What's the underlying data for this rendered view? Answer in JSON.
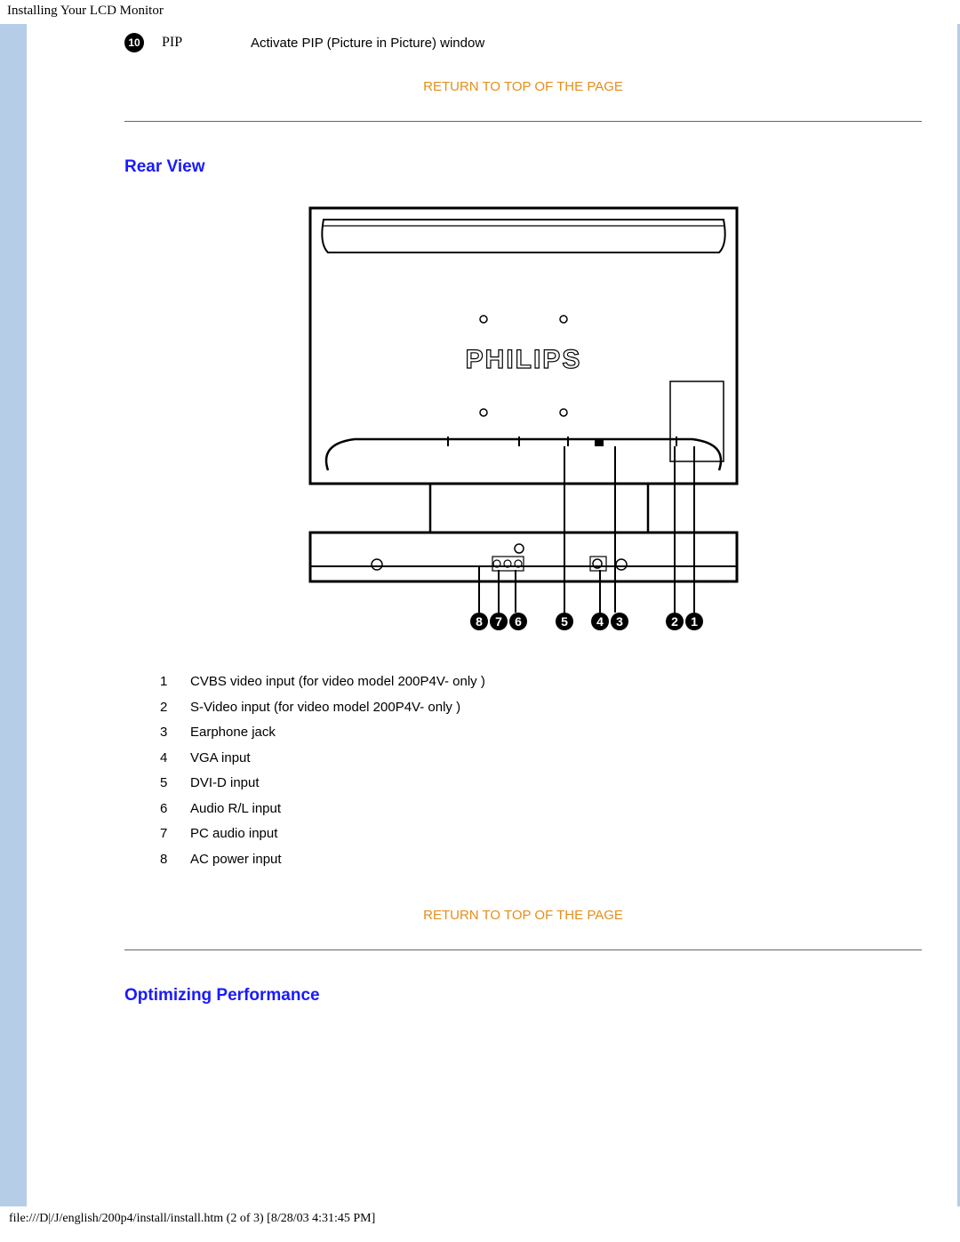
{
  "header": {
    "title": "Installing Your LCD Monitor"
  },
  "pip": {
    "badge": "10",
    "label": "PIP",
    "desc": "Activate PIP (Picture in Picture) window"
  },
  "links": {
    "return_top": "RETURN TO TOP OF THE PAGE"
  },
  "sections": {
    "rear_view": "Rear View",
    "optimizing": "Optimizing Performance"
  },
  "diagram": {
    "brand": "PHILIPS",
    "callouts": [
      "8",
      "7",
      "6",
      "5",
      "4",
      "3",
      "2",
      "1"
    ]
  },
  "ports": [
    {
      "n": "1",
      "label": "CVBS video input (for video model 200P4V- only )"
    },
    {
      "n": "2",
      "label": "S-Video input (for video model 200P4V- only )"
    },
    {
      "n": "3",
      "label": "Earphone jack"
    },
    {
      "n": "4",
      "label": "VGA input"
    },
    {
      "n": "5",
      "label": "DVI-D input"
    },
    {
      "n": "6",
      "label": "Audio R/L input"
    },
    {
      "n": "7",
      "label": "PC audio input"
    },
    {
      "n": "8",
      "label": "AC power input"
    }
  ],
  "footer": {
    "path": "file:///D|/J/english/200p4/install/install.htm (2 of 3) [8/28/03 4:31:45 PM]"
  }
}
